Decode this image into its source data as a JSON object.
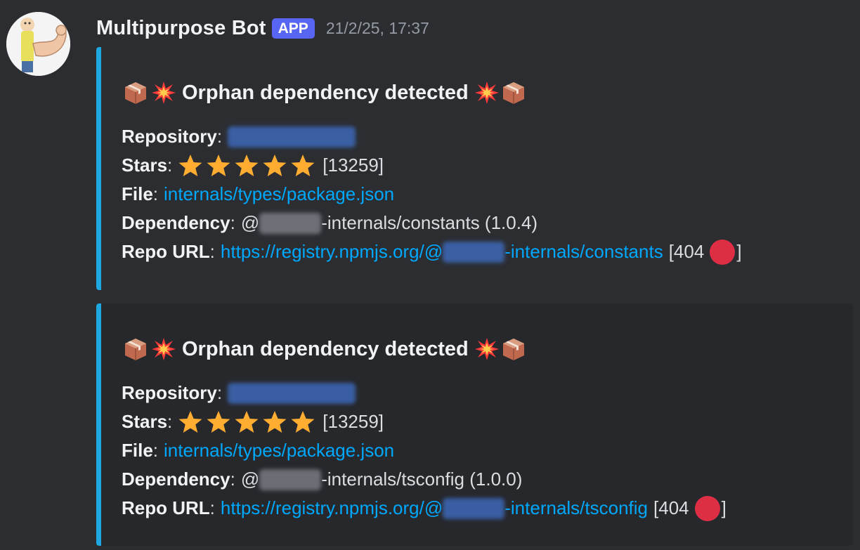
{
  "message": {
    "bot_name": "Multipurpose Bot",
    "badge": "APP",
    "timestamp": "21/2/25, 17:37",
    "avatar_icon": "muscle-arm-character-avatar"
  },
  "embeds": [
    {
      "title": "Orphan dependency detected",
      "title_icons": [
        "package-icon",
        "collision-icon"
      ],
      "repository_label": "Repository",
      "stars_label": "Stars",
      "stars_count": "[13259]",
      "stars_rating": 5,
      "file_label": "File",
      "file_value": "internals/types/package.json",
      "dependency_label": "Dependency",
      "dependency_prefix": "@",
      "dependency_value": "-internals/constants (1.0.4)",
      "repo_url_label": "Repo URL",
      "repo_url_prefix": "https://registry.npmjs.org/@",
      "repo_url_suffix": "-internals/constants",
      "status_text": "[404",
      "status_close": "]"
    },
    {
      "title": "Orphan dependency detected",
      "title_icons": [
        "package-icon",
        "collision-icon"
      ],
      "repository_label": "Repository",
      "stars_label": "Stars",
      "stars_count": "[13259]",
      "stars_rating": 5,
      "file_label": "File",
      "file_value": "internals/types/package.json",
      "dependency_label": "Dependency",
      "dependency_prefix": "@",
      "dependency_value": "-internals/tsconfig (1.0.0)",
      "repo_url_label": "Repo URL",
      "repo_url_prefix": "https://registry.npmjs.org/@",
      "repo_url_suffix": "-internals/tsconfig",
      "status_text": "[404",
      "status_close": "]"
    }
  ],
  "colors": {
    "background": "#2b2d31",
    "accent_bar": "#1ea7e1",
    "link": "#00a8fc",
    "app_badge": "#5865f2",
    "star": "#ffac33",
    "status_dot": "#dd2e44"
  }
}
